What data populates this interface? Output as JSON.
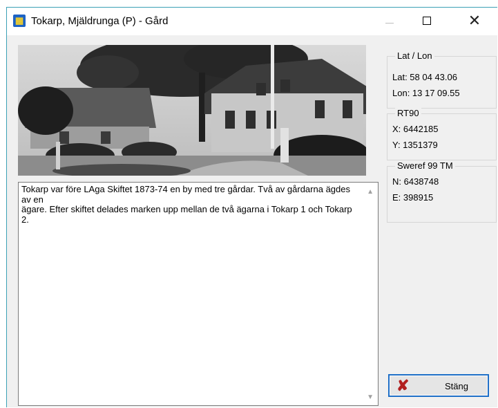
{
  "window": {
    "title": "Tokarp, Mjäldrunga (P) - Gård",
    "controls": {
      "minimize_icon": "minimize-icon",
      "maximize_icon": "maximize-icon",
      "close_icon": "close-icon"
    }
  },
  "description": "Tokarp var före LAga Skiftet 1873-74 en by med tre gårdar. Två av gårdarna ägdes av en\nägare. Efter skiftet delades marken upp mellan de två ägarna i Tokarp 1 och Tokarp 2.",
  "coordinates": {
    "latlon": {
      "title": "Lat / Lon",
      "lat": "Lat: 58 04 43.06",
      "lon": "Lon: 13 17 09.55"
    },
    "rt90": {
      "title": "RT90",
      "x": "X: 6442185",
      "y": "Y: 1351379"
    },
    "sweref": {
      "title": "Sweref 99 TM",
      "n": "N: 6438748",
      "e": "E: 398915"
    }
  },
  "buttons": {
    "close_label": "Stäng",
    "close_icon": "red-x-icon"
  },
  "colors": {
    "accent": "#1f6fc7",
    "close_icon": "#b22020",
    "window_bg": "#f0f0f0"
  }
}
